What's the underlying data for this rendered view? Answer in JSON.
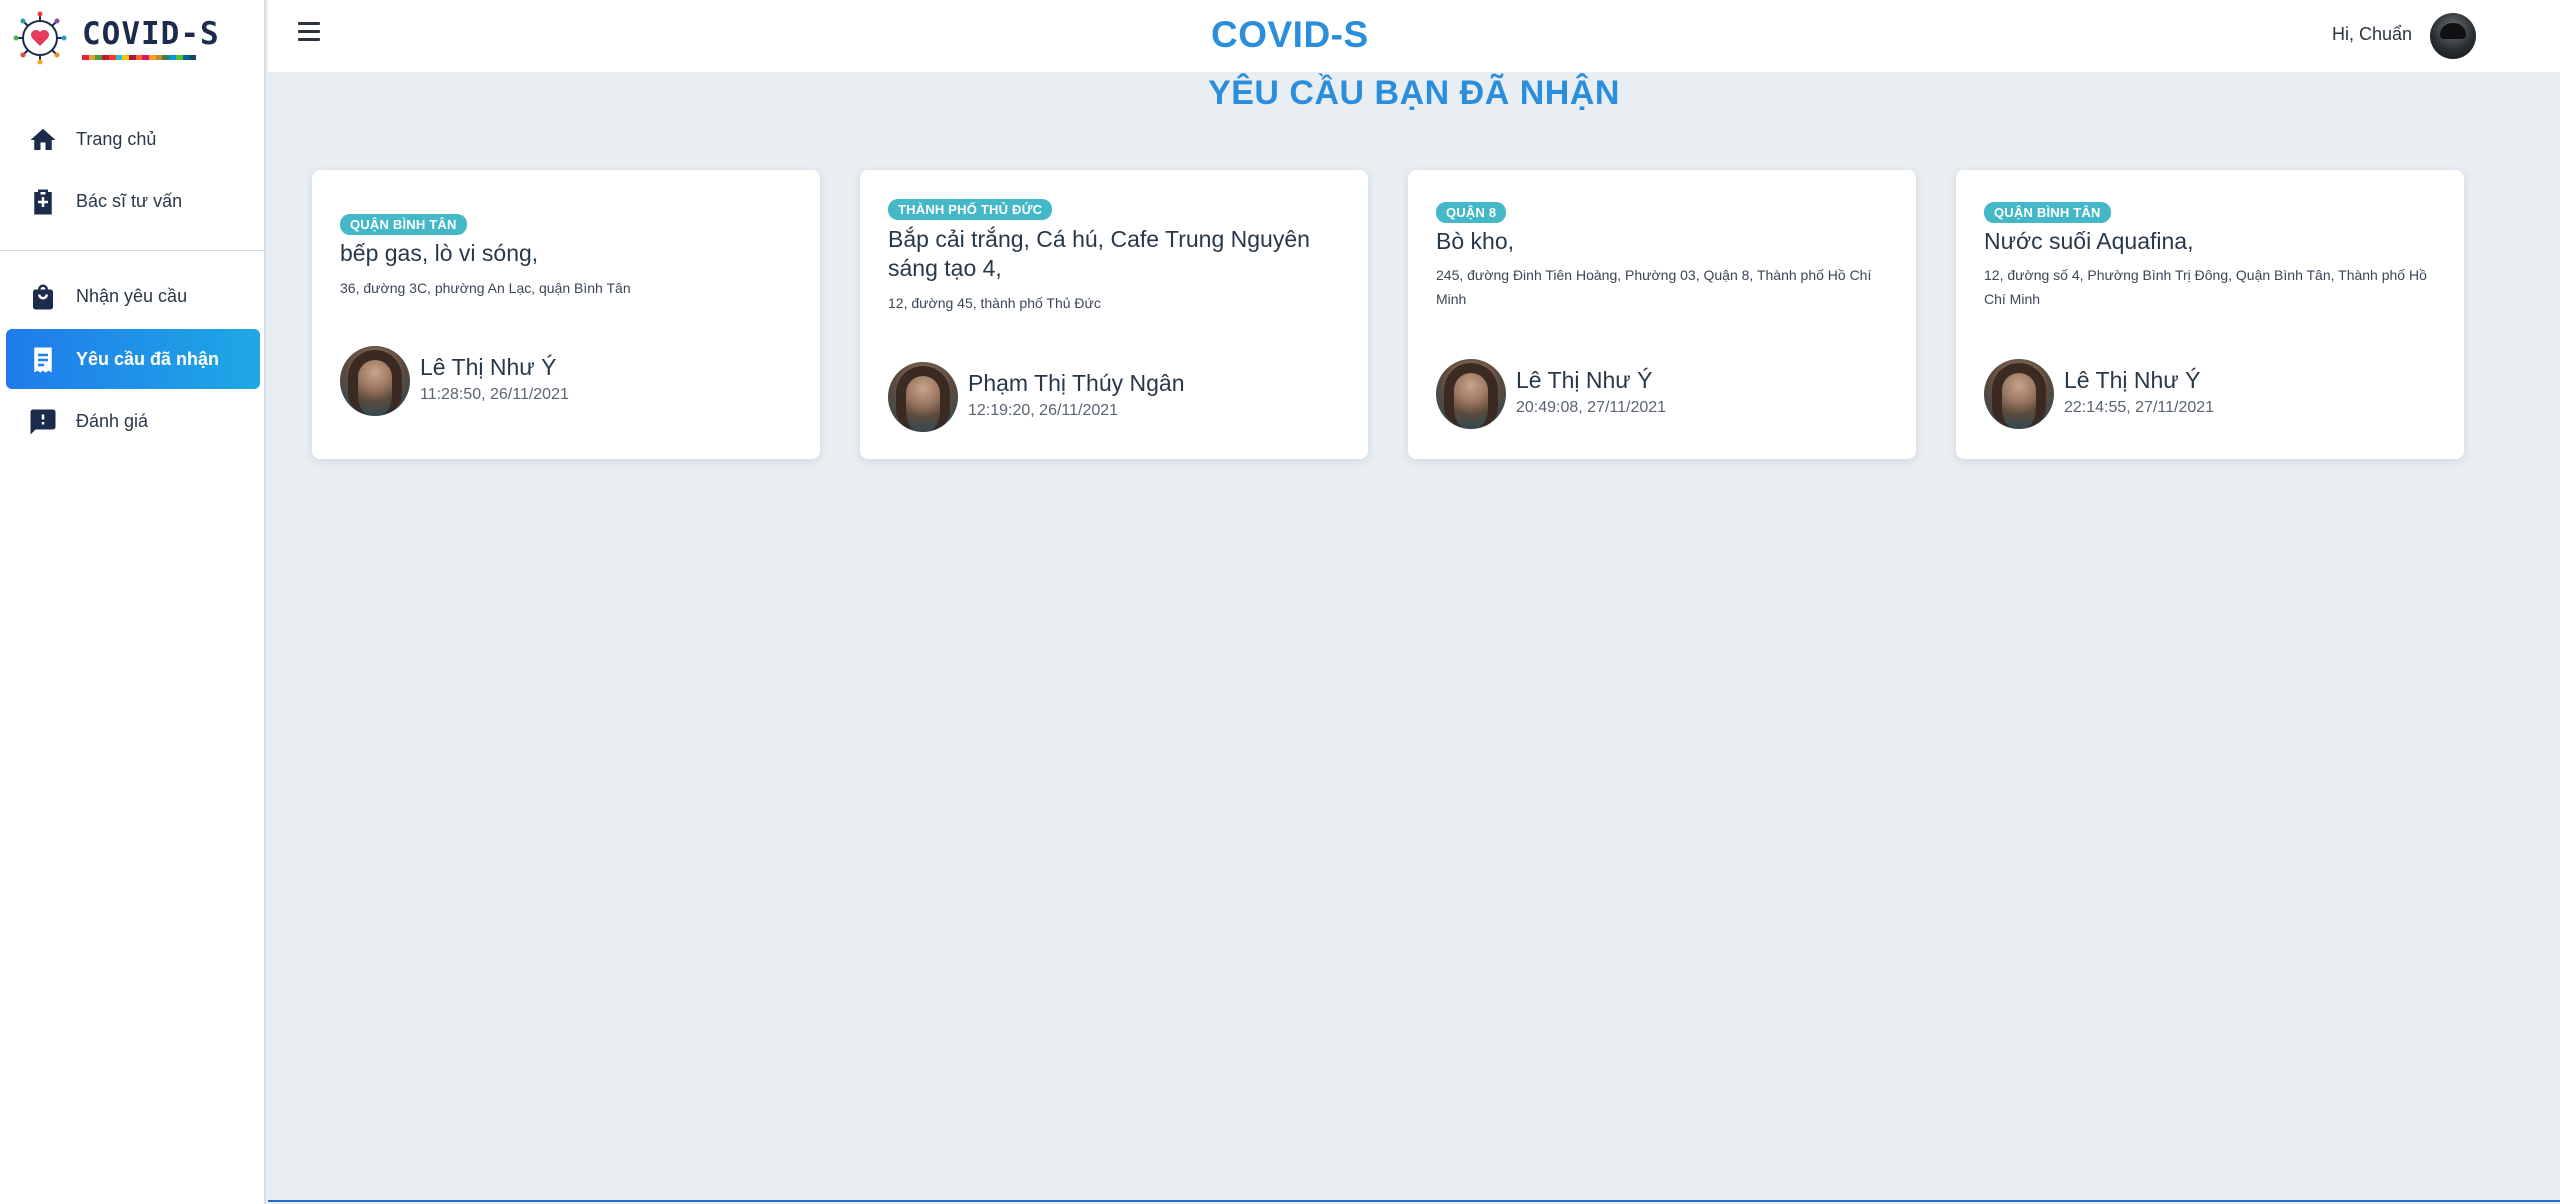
{
  "app": {
    "title": "COVID-S",
    "logo_text": "COVID-S"
  },
  "header": {
    "greeting": "Hi, Chuẩn"
  },
  "sidebar": {
    "items": [
      {
        "label": "Trang chủ",
        "icon": "home-icon"
      },
      {
        "label": "Bác sĩ tư vấn",
        "icon": "medical-kit-icon"
      },
      {
        "label": "Nhận yêu cầu",
        "icon": "shopping-bag-icon"
      },
      {
        "label": "Yêu cầu đã nhận",
        "icon": "receipt-icon",
        "active": true
      },
      {
        "label": "Đánh giá",
        "icon": "feedback-icon"
      }
    ]
  },
  "main": {
    "title": "YÊU CẦU BẠN ĐÃ NHẬN",
    "cards": [
      {
        "district": "QUẬN BÌNH TÂN",
        "items": "bếp gas, lò vi sóng,",
        "address": "36, đường 3C, phường An Lạc, quận Bình Tân",
        "name": "Lê Thị Như Ý",
        "time": "11:28:50, 26/11/2021"
      },
      {
        "district": "THÀNH PHỐ THỦ ĐỨC",
        "items": "Bắp cải trắng, Cá hú, Cafe Trung Nguyên sáng tạo 4,",
        "address": "12, đường 45, thành phố Thủ Đức",
        "name": "Phạm Thị Thúy Ngân",
        "time": "12:19:20, 26/11/2021"
      },
      {
        "district": "QUẬN 8",
        "items": "Bò kho,",
        "address": "245, đường Đinh Tiên Hoàng, Phường 03, Quận 8, Thành phố Hồ Chí Minh",
        "name": "Lê Thị Như Ý",
        "time": "20:49:08, 27/11/2021"
      },
      {
        "district": "QUẬN BÌNH TÂN",
        "items": "Nước suối Aquafina,",
        "address": "12, đường số 4, Phường Bình Trị Đông, Quận Bình Tân, Thành phố Hồ Chí Minh",
        "name": "Lê Thị Như Ý",
        "time": "22:14:55, 27/11/2021"
      }
    ]
  },
  "colors": {
    "primary": "#2b8edc",
    "badge": "#45b8c8",
    "active_start": "#1f7bec",
    "active_end": "#1fa8e4",
    "background": "#e9eef3"
  }
}
